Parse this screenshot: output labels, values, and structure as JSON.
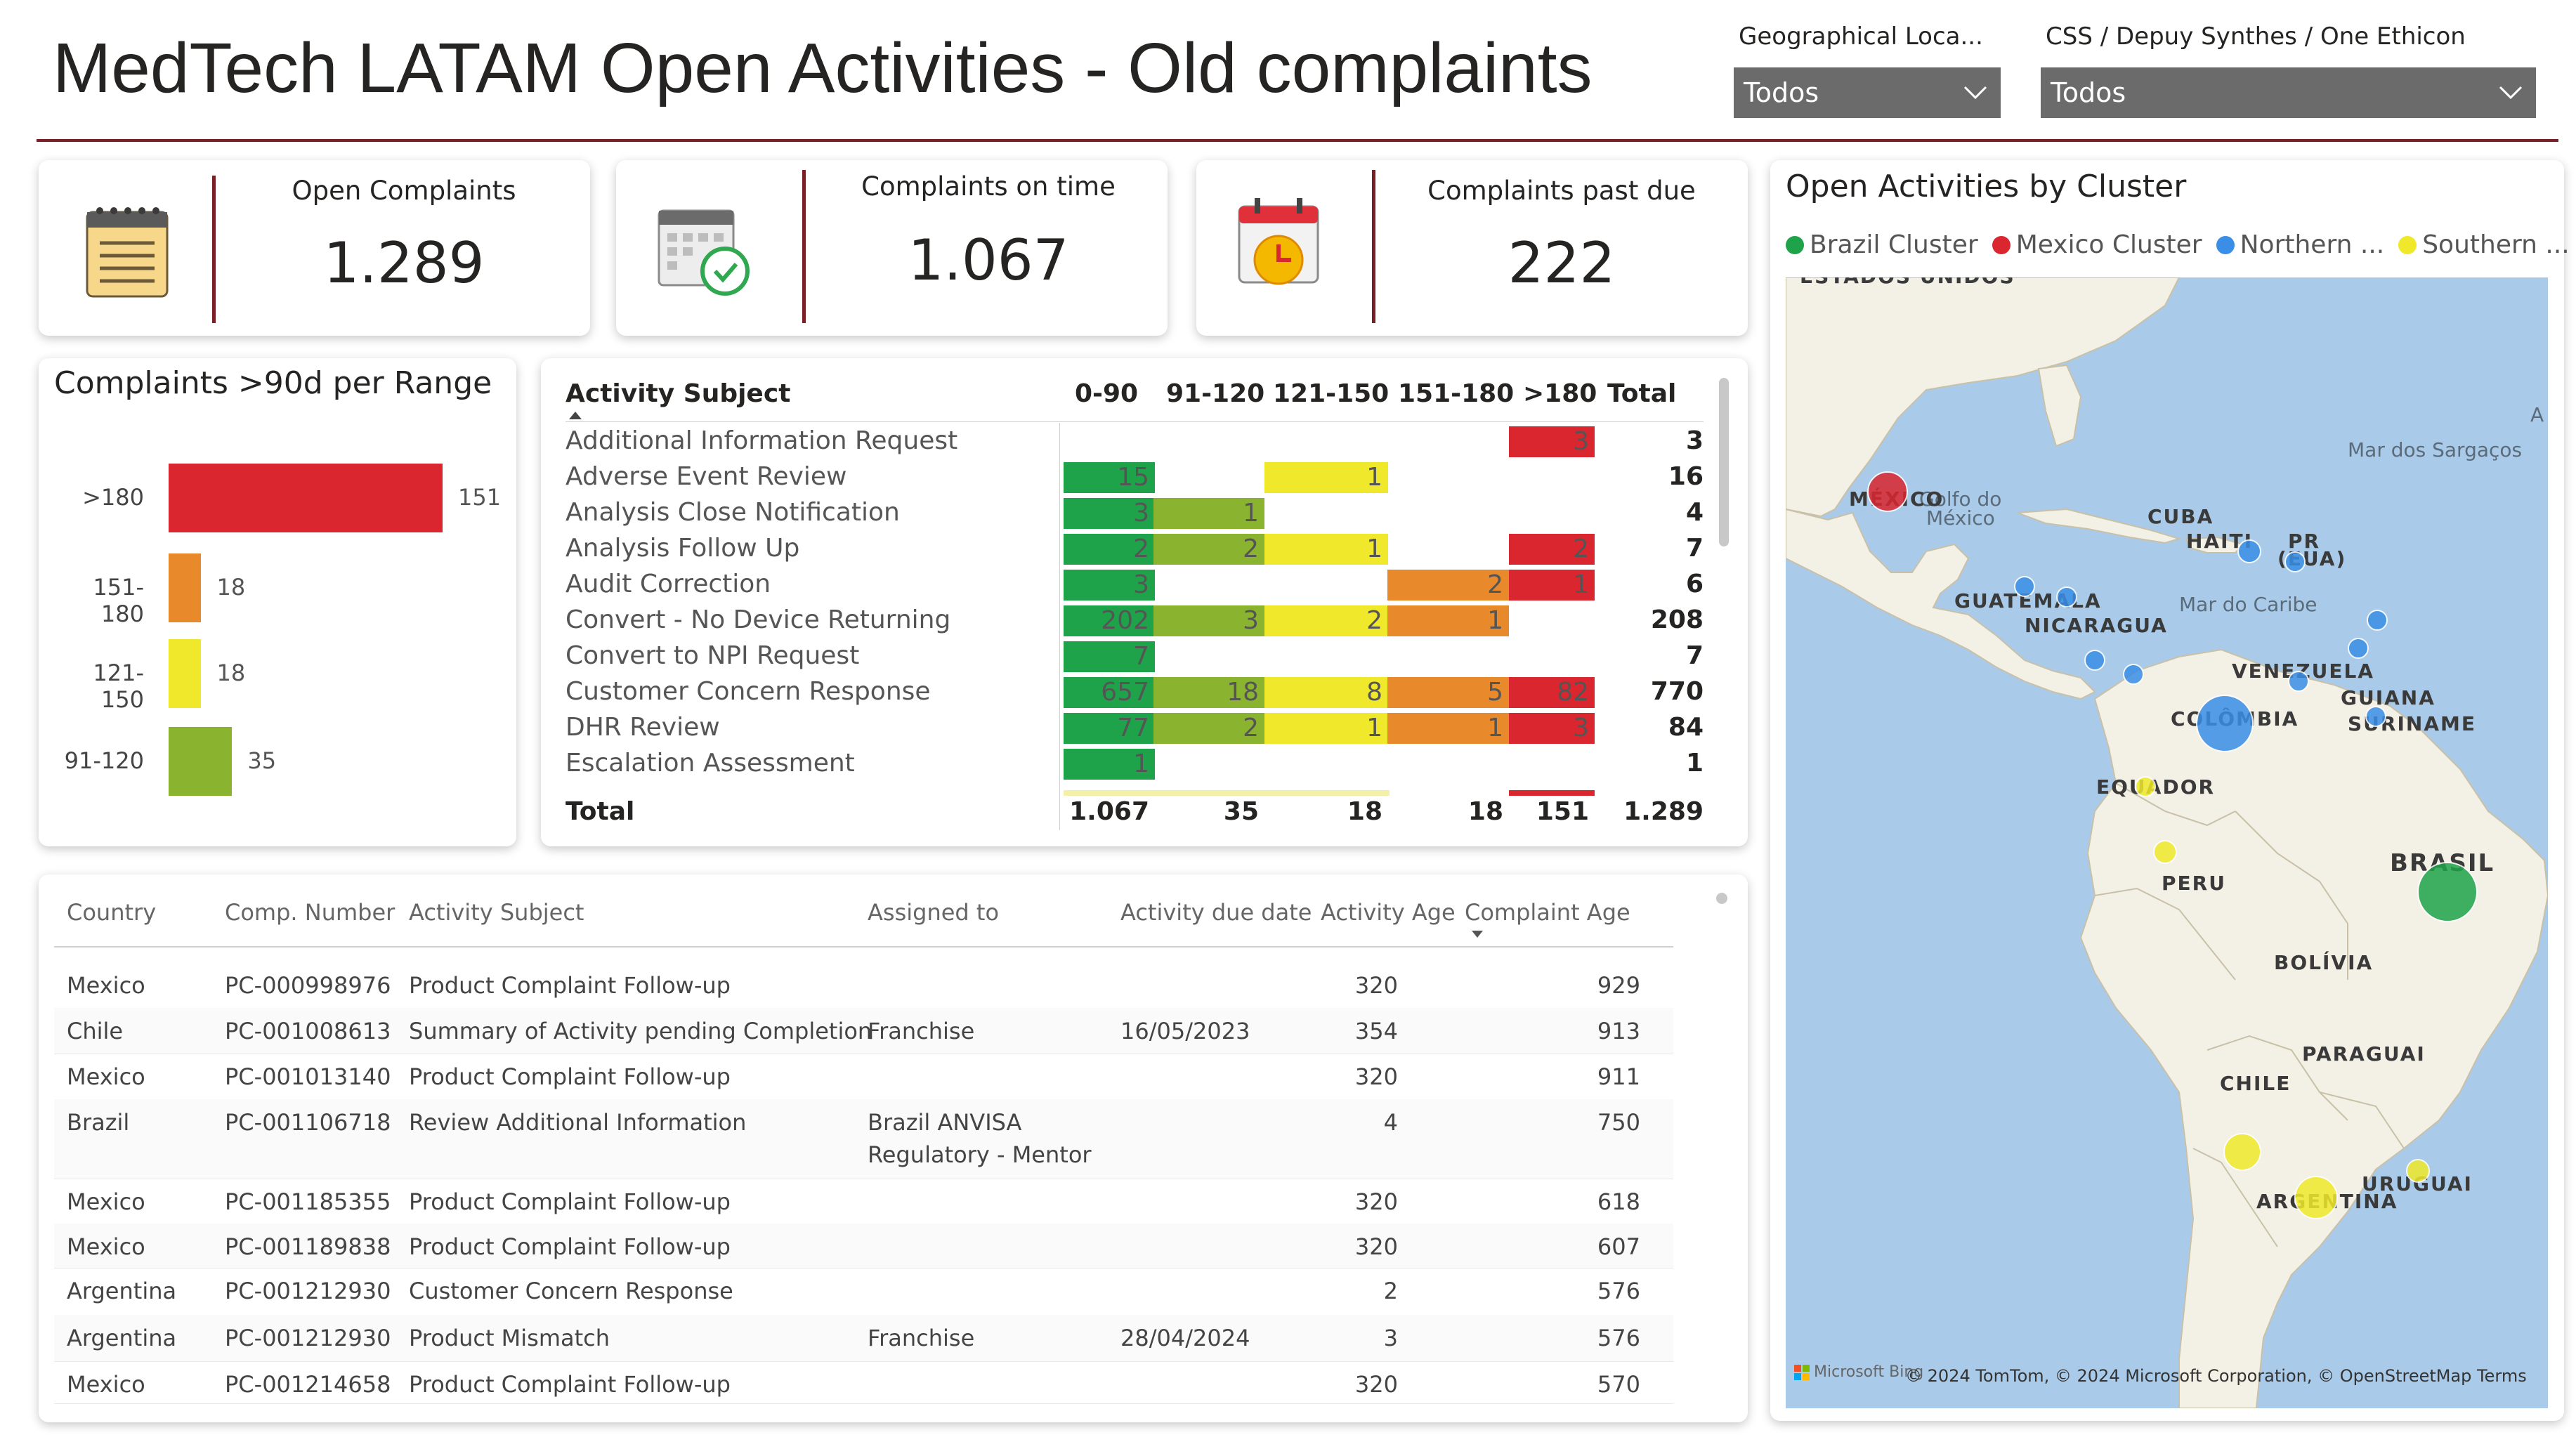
{
  "header": {
    "title": "MedTech LATAM Open Activities - Old complaints",
    "filters": [
      {
        "label": "Geographical Loca...",
        "value": "Todos"
      },
      {
        "label": "CSS / Depuy Synthes / One Ethicon",
        "value": "Todos"
      }
    ]
  },
  "kpis": [
    {
      "label": "Open Complaints",
      "value": "1.289",
      "icon": "notepad-icon"
    },
    {
      "label": "Complaints on time",
      "value": "1.067",
      "icon": "calendar-check-icon"
    },
    {
      "label": "Complaints past due",
      "value": "222",
      "icon": "calendar-clock-icon"
    }
  ],
  "range_chart": {
    "title": "Complaints >90d per Range",
    "chart_data": {
      "type": "bar",
      "orientation": "horizontal",
      "categories": [
        ">180",
        "151-180",
        "121-150",
        "91-120"
      ],
      "values": [
        151,
        18,
        18,
        35
      ],
      "colors": [
        "#d9262f",
        "#e8892c",
        "#f0e92b",
        "#8ab42f"
      ]
    }
  },
  "matrix": {
    "headers": [
      "Activity Subject",
      "0-90",
      "91-120",
      "121-150",
      "151-180",
      ">180",
      "Total"
    ],
    "rows": [
      {
        "subject": "Additional Information Request",
        "cells": [
          "",
          "",
          "",
          "",
          "3"
        ],
        "total": "3"
      },
      {
        "subject": "Adverse Event Review",
        "cells": [
          "15",
          "",
          "1",
          "",
          ""
        ],
        "total": "16"
      },
      {
        "subject": "Analysis Close Notification",
        "cells": [
          "3",
          "1",
          "",
          "",
          ""
        ],
        "total": "4"
      },
      {
        "subject": "Analysis Follow Up",
        "cells": [
          "2",
          "2",
          "1",
          "",
          "2"
        ],
        "total": "7"
      },
      {
        "subject": "Audit Correction",
        "cells": [
          "3",
          "",
          "",
          "2",
          "1"
        ],
        "total": "6"
      },
      {
        "subject": "Convert - No Device Returning",
        "cells": [
          "202",
          "3",
          "2",
          "1",
          ""
        ],
        "total": "208"
      },
      {
        "subject": "Convert to NPI Request",
        "cells": [
          "7",
          "",
          "",
          "",
          ""
        ],
        "total": "7"
      },
      {
        "subject": "Customer Concern Response",
        "cells": [
          "657",
          "18",
          "8",
          "5",
          "82"
        ],
        "total": "770"
      },
      {
        "subject": "DHR Review",
        "cells": [
          "77",
          "2",
          "1",
          "1",
          "3"
        ],
        "total": "84"
      },
      {
        "subject": "Escalation Assessment",
        "cells": [
          "1",
          "",
          "",
          "",
          ""
        ],
        "total": "1"
      }
    ],
    "totals": {
      "label": "Total",
      "cells": [
        "1.067",
        "35",
        "18",
        "18",
        "151"
      ],
      "total": "1.289"
    },
    "colors": [
      "#1fa34a",
      "#8ab42f",
      "#f0e92b",
      "#e8892c",
      "#d9262f"
    ]
  },
  "table": {
    "columns": [
      "Country",
      "Comp. Number",
      "Activity Subject",
      "Assigned to",
      "Activity due date",
      "Activity Age",
      "Complaint Age"
    ],
    "rows": [
      [
        "Mexico",
        "PC-000998976",
        "Product Complaint Follow-up",
        "",
        "",
        "320",
        "929"
      ],
      [
        "Chile",
        "PC-001008613",
        "Summary of Activity pending Completion",
        "Franchise",
        "16/05/2023",
        "354",
        "913"
      ],
      [
        "Mexico",
        "PC-001013140",
        "Product Complaint Follow-up",
        "",
        "",
        "320",
        "911"
      ],
      [
        "Brazil",
        "PC-001106718",
        "Review Additional Information",
        "Brazil ANVISA",
        "",
        "4",
        "750"
      ],
      [
        "Mexico",
        "PC-001185355",
        "Product Complaint Follow-up",
        "",
        "",
        "320",
        "618"
      ],
      [
        "Mexico",
        "PC-001189838",
        "Product Complaint Follow-up",
        "",
        "",
        "320",
        "607"
      ],
      [
        "Argentina",
        "PC-001212930",
        "Customer Concern Response",
        "",
        "",
        "2",
        "576"
      ],
      [
        "Argentina",
        "PC-001212930",
        "Product Mismatch",
        "Franchise",
        "28/04/2024",
        "3",
        "576"
      ],
      [
        "Mexico",
        "PC-001214658",
        "Product Complaint Follow-up",
        "",
        "",
        "320",
        "570"
      ]
    ],
    "row4_assigned_line2": "Regulatory - Mentor"
  },
  "map": {
    "title": "Open Activities by Cluster",
    "legend": [
      {
        "name": "Brazil Cluster",
        "color": "#1fa34a"
      },
      {
        "name": "Mexico Cluster",
        "color": "#d9262f"
      },
      {
        "name": "Northern ...",
        "color": "#3a8ee6"
      },
      {
        "name": "Southern ...",
        "color": "#f0e92b"
      }
    ],
    "labels": {
      "usa": "ESTADOS UNIDOS",
      "gulf1": "Golfo do",
      "gulf2": "México",
      "sargasso": "Mar dos Sargaços",
      "mexico": "MÉXICO",
      "cuba": "CUBA",
      "haiti": "HAITI",
      "pr1": "PR",
      "pr2": "(EUA)",
      "guatemala": "GUATEMALA",
      "nicaragua": "NICARAGUA",
      "caribe": "Mar do Caribe",
      "venezuela": "VENEZUELA",
      "guiana": "GUIANA",
      "suriname": "SURINAME",
      "colombia": "COLÔMBIA",
      "equador": "EQUADOR",
      "peru": "PERU",
      "brasil": "BRASIL",
      "bolivia": "BOLÍVIA",
      "paraguai": "PARAGUAI",
      "chile": "CHILE",
      "uruguai": "URUGUAI",
      "argentina": "ARGENTINA",
      "a": "A"
    },
    "attribution": "© 2024 TomTom, © 2024 Microsoft Corporation, © OpenStreetMap  Terms",
    "brand": "Microsoft Bing"
  }
}
